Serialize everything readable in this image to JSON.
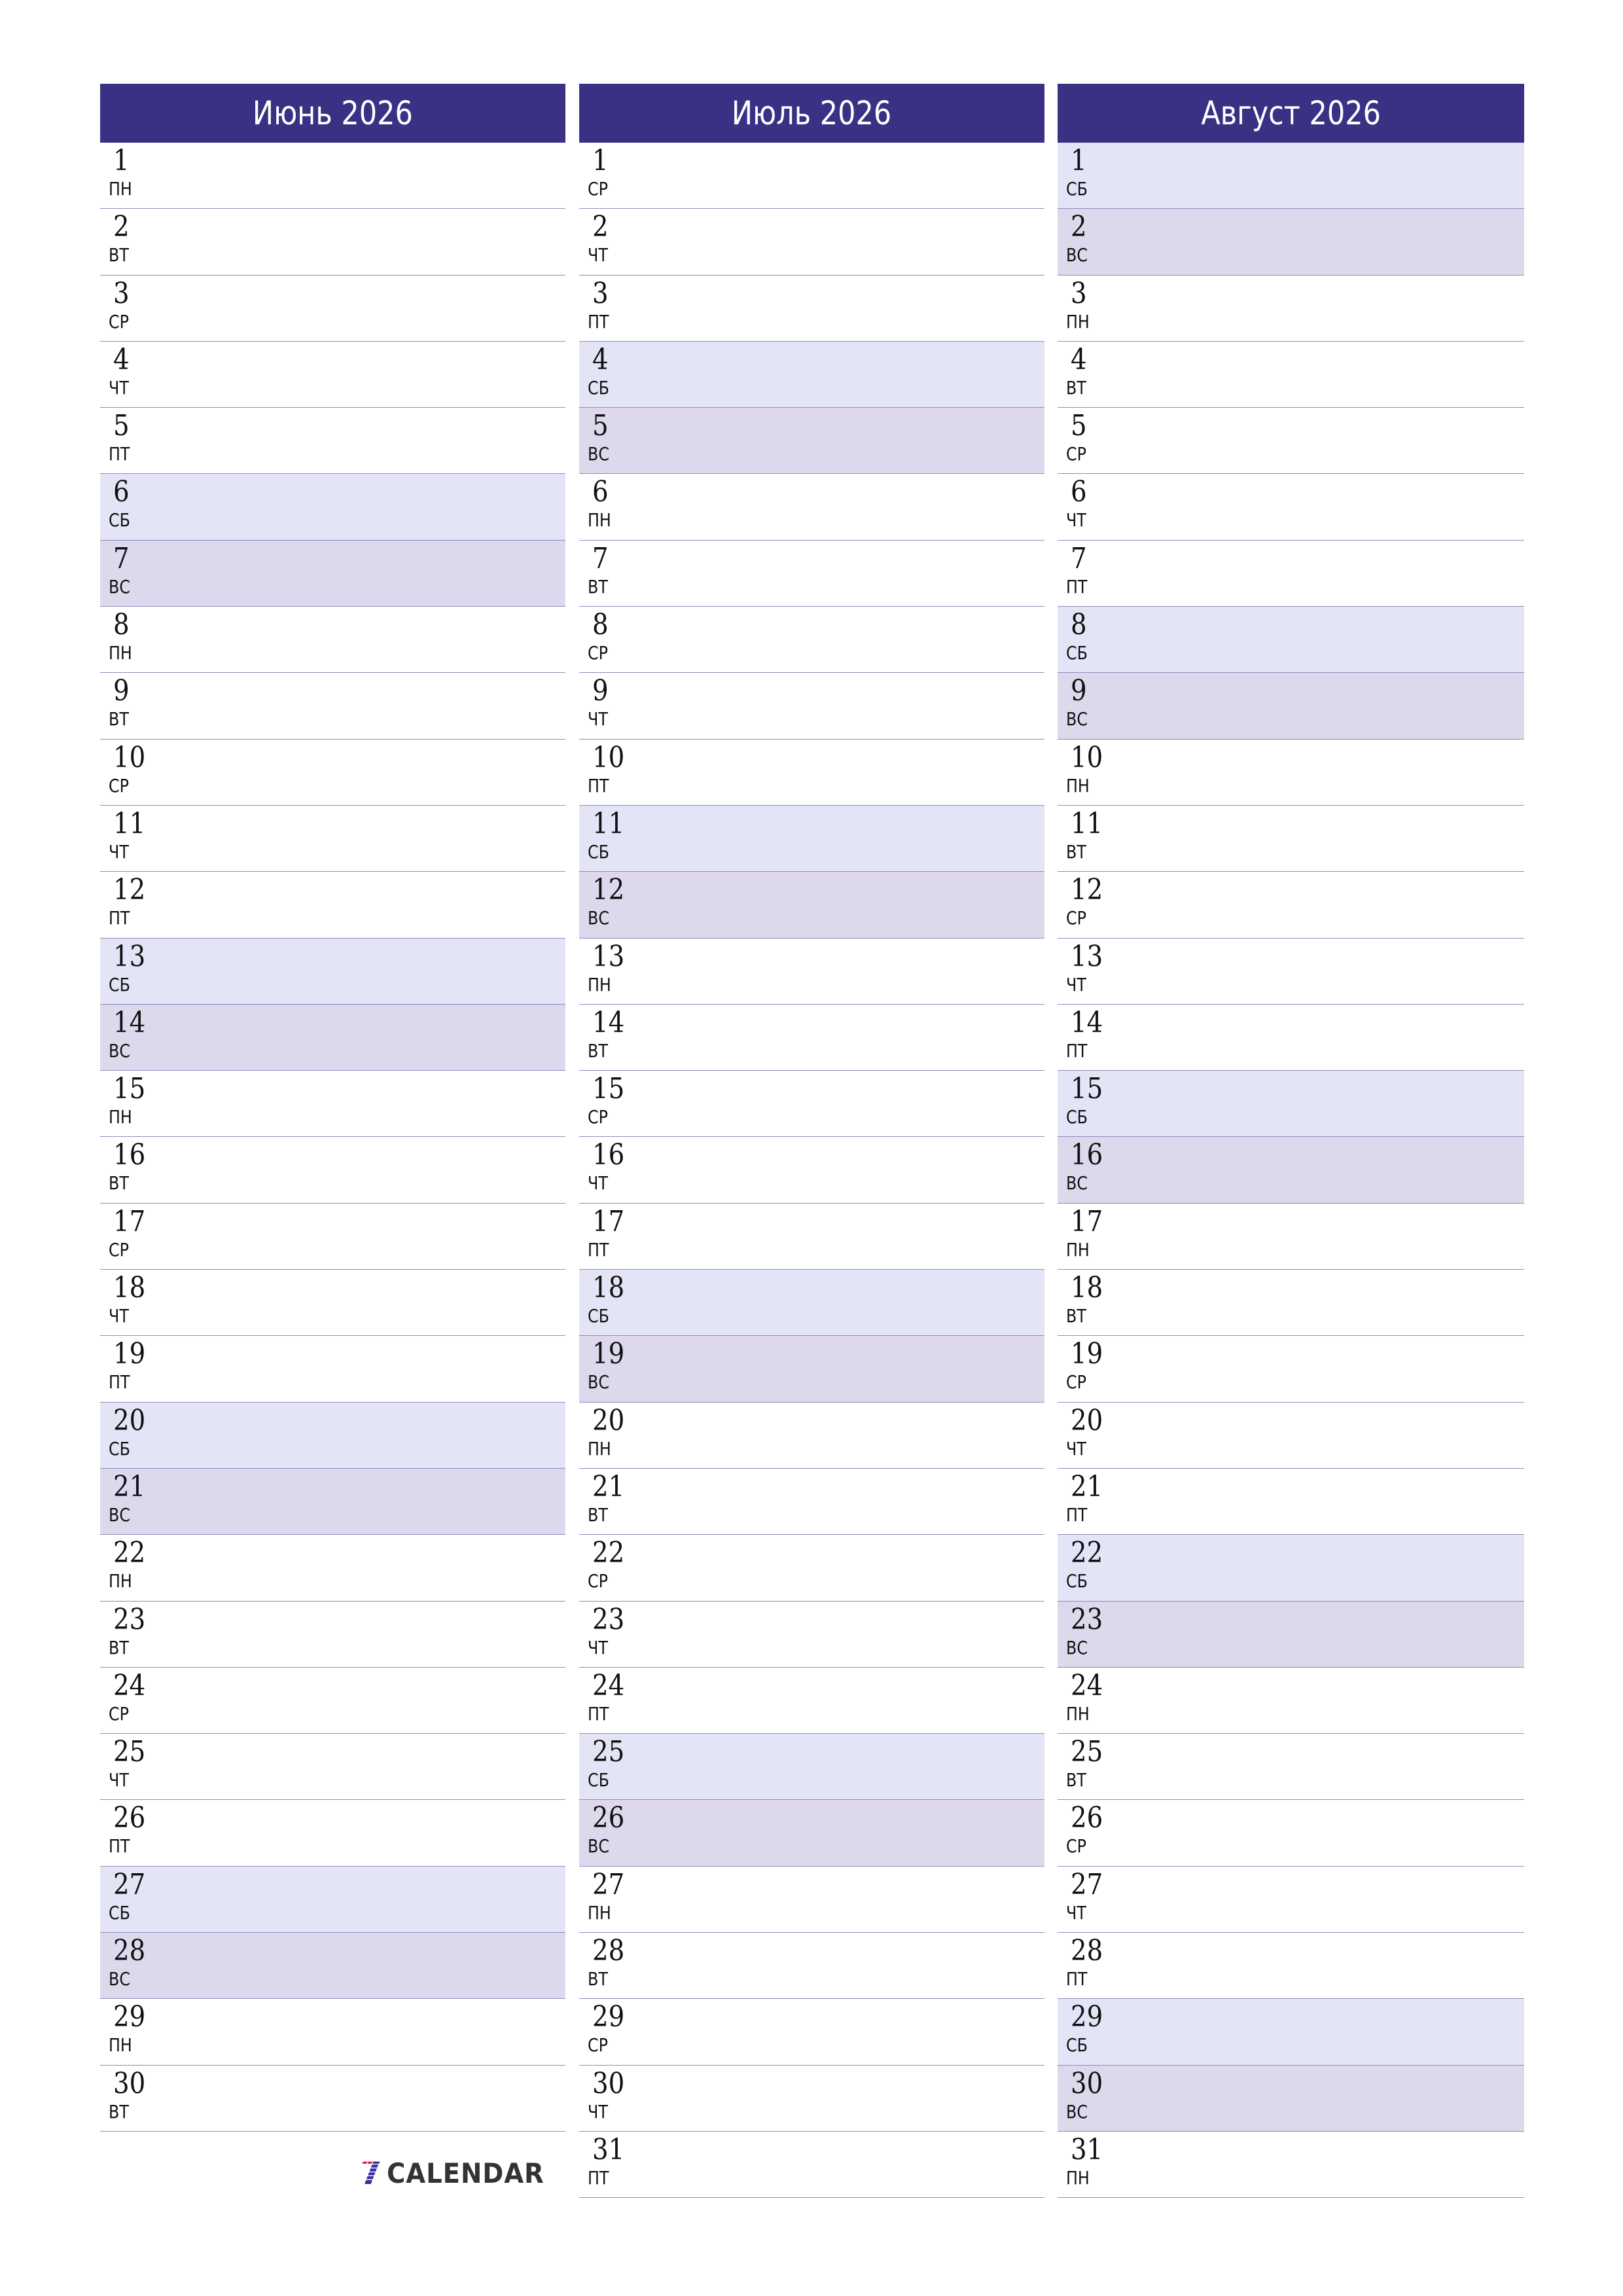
{
  "colors": {
    "header_bg": "#3A3184",
    "header_text": "#FFFFFF",
    "saturday_bg": "#E4E4F7",
    "sunday_bg": "#DDD8EC",
    "separator": "#8F8BBE",
    "logo_red": "#E8174A",
    "logo_indigo": "#3A2A9A",
    "logo_text": "#333333"
  },
  "months": [
    {
      "title": "Июнь 2026",
      "days": [
        {
          "n": "1",
          "d": "ПН"
        },
        {
          "n": "2",
          "d": "ВТ"
        },
        {
          "n": "3",
          "d": "СР"
        },
        {
          "n": "4",
          "d": "ЧТ"
        },
        {
          "n": "5",
          "d": "ПТ"
        },
        {
          "n": "6",
          "d": "СБ"
        },
        {
          "n": "7",
          "d": "ВС"
        },
        {
          "n": "8",
          "d": "ПН"
        },
        {
          "n": "9",
          "d": "ВТ"
        },
        {
          "n": "10",
          "d": "СР"
        },
        {
          "n": "11",
          "d": "ЧТ"
        },
        {
          "n": "12",
          "d": "ПТ"
        },
        {
          "n": "13",
          "d": "СБ"
        },
        {
          "n": "14",
          "d": "ВС"
        },
        {
          "n": "15",
          "d": "ПН"
        },
        {
          "n": "16",
          "d": "ВТ"
        },
        {
          "n": "17",
          "d": "СР"
        },
        {
          "n": "18",
          "d": "ЧТ"
        },
        {
          "n": "19",
          "d": "ПТ"
        },
        {
          "n": "20",
          "d": "СБ"
        },
        {
          "n": "21",
          "d": "ВС"
        },
        {
          "n": "22",
          "d": "ПН"
        },
        {
          "n": "23",
          "d": "ВТ"
        },
        {
          "n": "24",
          "d": "СР"
        },
        {
          "n": "25",
          "d": "ЧТ"
        },
        {
          "n": "26",
          "d": "ПТ"
        },
        {
          "n": "27",
          "d": "СБ"
        },
        {
          "n": "28",
          "d": "ВС"
        },
        {
          "n": "29",
          "d": "ПН"
        },
        {
          "n": "30",
          "d": "ВТ"
        }
      ]
    },
    {
      "title": "Июль 2026",
      "days": [
        {
          "n": "1",
          "d": "СР"
        },
        {
          "n": "2",
          "d": "ЧТ"
        },
        {
          "n": "3",
          "d": "ПТ"
        },
        {
          "n": "4",
          "d": "СБ"
        },
        {
          "n": "5",
          "d": "ВС"
        },
        {
          "n": "6",
          "d": "ПН"
        },
        {
          "n": "7",
          "d": "ВТ"
        },
        {
          "n": "8",
          "d": "СР"
        },
        {
          "n": "9",
          "d": "ЧТ"
        },
        {
          "n": "10",
          "d": "ПТ"
        },
        {
          "n": "11",
          "d": "СБ"
        },
        {
          "n": "12",
          "d": "ВС"
        },
        {
          "n": "13",
          "d": "ПН"
        },
        {
          "n": "14",
          "d": "ВТ"
        },
        {
          "n": "15",
          "d": "СР"
        },
        {
          "n": "16",
          "d": "ЧТ"
        },
        {
          "n": "17",
          "d": "ПТ"
        },
        {
          "n": "18",
          "d": "СБ"
        },
        {
          "n": "19",
          "d": "ВС"
        },
        {
          "n": "20",
          "d": "ПН"
        },
        {
          "n": "21",
          "d": "ВТ"
        },
        {
          "n": "22",
          "d": "СР"
        },
        {
          "n": "23",
          "d": "ЧТ"
        },
        {
          "n": "24",
          "d": "ПТ"
        },
        {
          "n": "25",
          "d": "СБ"
        },
        {
          "n": "26",
          "d": "ВС"
        },
        {
          "n": "27",
          "d": "ПН"
        },
        {
          "n": "28",
          "d": "ВТ"
        },
        {
          "n": "29",
          "d": "СР"
        },
        {
          "n": "30",
          "d": "ЧТ"
        },
        {
          "n": "31",
          "d": "ПТ"
        }
      ]
    },
    {
      "title": "Август 2026",
      "days": [
        {
          "n": "1",
          "d": "СБ"
        },
        {
          "n": "2",
          "d": "ВС"
        },
        {
          "n": "3",
          "d": "ПН"
        },
        {
          "n": "4",
          "d": "ВТ"
        },
        {
          "n": "5",
          "d": "СР"
        },
        {
          "n": "6",
          "d": "ЧТ"
        },
        {
          "n": "7",
          "d": "ПТ"
        },
        {
          "n": "8",
          "d": "СБ"
        },
        {
          "n": "9",
          "d": "ВС"
        },
        {
          "n": "10",
          "d": "ПН"
        },
        {
          "n": "11",
          "d": "ВТ"
        },
        {
          "n": "12",
          "d": "СР"
        },
        {
          "n": "13",
          "d": "ЧТ"
        },
        {
          "n": "14",
          "d": "ПТ"
        },
        {
          "n": "15",
          "d": "СБ"
        },
        {
          "n": "16",
          "d": "ВС"
        },
        {
          "n": "17",
          "d": "ПН"
        },
        {
          "n": "18",
          "d": "ВТ"
        },
        {
          "n": "19",
          "d": "СР"
        },
        {
          "n": "20",
          "d": "ЧТ"
        },
        {
          "n": "21",
          "d": "ПТ"
        },
        {
          "n": "22",
          "d": "СБ"
        },
        {
          "n": "23",
          "d": "ВС"
        },
        {
          "n": "24",
          "d": "ПН"
        },
        {
          "n": "25",
          "d": "ВТ"
        },
        {
          "n": "26",
          "d": "СР"
        },
        {
          "n": "27",
          "d": "ЧТ"
        },
        {
          "n": "28",
          "d": "ПТ"
        },
        {
          "n": "29",
          "d": "СБ"
        },
        {
          "n": "30",
          "d": "ВС"
        },
        {
          "n": "31",
          "d": "ПН"
        }
      ]
    }
  ],
  "weekend": {
    "saturday": "СБ",
    "sunday": "ВС"
  },
  "logo": {
    "text": "CALENDAR",
    "icon": "seven-logo-icon"
  }
}
